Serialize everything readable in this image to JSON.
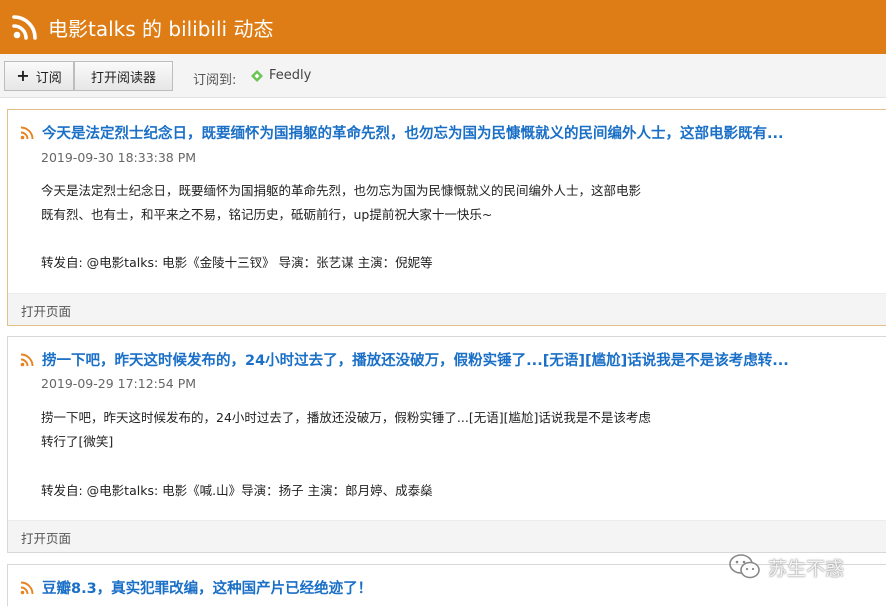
{
  "header": {
    "title": "电影talks 的 bilibili 动态",
    "icon": "rss-icon",
    "color": "#de7d16"
  },
  "toolbar": {
    "subscribe_label": "订阅",
    "open_reader_label": "打开阅读器",
    "subscribe_to_label": "订阅到:",
    "feedly_label": "Feedly"
  },
  "items": [
    {
      "title": "今天是法定烈士纪念日，既要缅怀为国捐躯的革命先烈，也勿忘为国为民慷慨就义的民间编外人士，这部电影既有...",
      "date": "2019-09-30 18:33:38 PM",
      "body_line1": "今天是法定烈士纪念日，既要缅怀为国捐躯的革命先烈，也勿忘为国为民慷慨就义的民间编外人士，这部电影",
      "body_line2": "既有烈、也有士，和平来之不易，铭记历史，砥砺前行，up提前祝大家十一快乐~",
      "forward": "转发自: @电影talks: 电影《金陵十三钗》 导演：张艺谋 主演：倪妮等",
      "open_page": "打开页面"
    },
    {
      "title": "捞一下吧，昨天这时候发布的，24小时过去了，播放还没破万，假粉实锤了...[无语][尴尬]话说我是不是该考虑转...",
      "date": "2019-09-29 17:12:54 PM",
      "body_line1": "捞一下吧，昨天这时候发布的，24小时过去了，播放还没破万，假粉实锤了...[无语][尴尬]话说我是不是该考虑",
      "body_line2": "转行了[微笑]",
      "forward": "转发自: @电影talks: 电影《喊.山》导演：扬子 主演：郎月婷、成泰燊",
      "open_page": "打开页面"
    },
    {
      "title": "豆瓣8.3，真实犯罪改编，这种国产片已经绝迹了！"
    }
  ],
  "watermark": {
    "text": "苏生不惑",
    "icon": "wechat-icon"
  }
}
